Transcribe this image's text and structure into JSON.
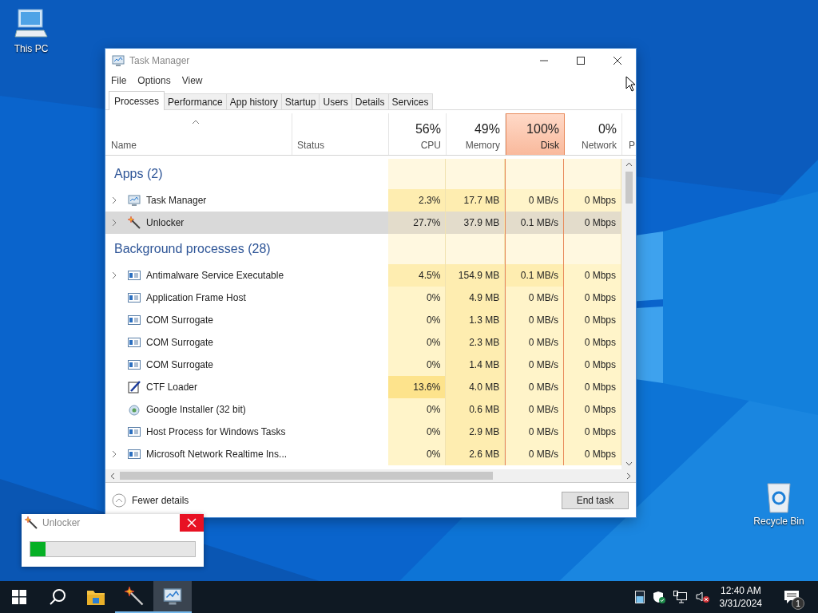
{
  "desktop_icons": [
    {
      "label": "This PC",
      "kind": "pc"
    },
    {
      "label": "Recycle Bin",
      "kind": "bin"
    }
  ],
  "task_manager": {
    "title": "Task Manager",
    "menu": [
      "File",
      "Options",
      "View"
    ],
    "tabs": [
      {
        "label": "Processes",
        "selected": true
      },
      {
        "label": "Performance",
        "selected": false
      },
      {
        "label": "App history",
        "selected": false
      },
      {
        "label": "Startup",
        "selected": false
      },
      {
        "label": "Users",
        "selected": false
      },
      {
        "label": "Details",
        "selected": false
      },
      {
        "label": "Services",
        "selected": false
      }
    ],
    "name_column": "Name",
    "status_column": "Status",
    "metric_columns": [
      {
        "label": "CPU",
        "percent": "56%",
        "selected": false
      },
      {
        "label": "Memory",
        "percent": "49%",
        "selected": false
      },
      {
        "label": "Disk",
        "percent": "100%",
        "selected": true
      },
      {
        "label": "Network",
        "percent": "0%",
        "selected": false
      }
    ],
    "cut_column": "P",
    "groups": [
      {
        "title": "Apps (2)",
        "rows": [
          {
            "name": "Task Manager",
            "kind": "monitor",
            "expandable": true,
            "selected": false,
            "cells": [
              {
                "text": "2.3%",
                "kind": "medium"
              },
              {
                "text": "17.7 MB",
                "kind": "medium"
              },
              {
                "text": "0 MB/s",
                "kind": "light"
              },
              {
                "text": "0 Mbps",
                "kind": "light"
              }
            ]
          },
          {
            "name": "Unlocker",
            "kind": "wand",
            "expandable": true,
            "selected": true,
            "cells": [
              {
                "text": "27.7%",
                "kind": "medium"
              },
              {
                "text": "37.9 MB",
                "kind": "medium"
              },
              {
                "text": "0.1 MB/s",
                "kind": "medium"
              },
              {
                "text": "0 Mbps",
                "kind": "light"
              }
            ]
          }
        ]
      },
      {
        "title": "Background processes (28)",
        "rows": [
          {
            "name": "Antimalware Service Executable",
            "kind": "service",
            "expandable": true,
            "selected": false,
            "cells": [
              {
                "text": "4.5%",
                "kind": "medium"
              },
              {
                "text": "154.9 MB",
                "kind": "medium"
              },
              {
                "text": "0.1 MB/s",
                "kind": "medium"
              },
              {
                "text": "0 Mbps",
                "kind": "light"
              }
            ]
          },
          {
            "name": "Application Frame Host",
            "kind": "service",
            "expandable": false,
            "selected": false,
            "cells": [
              {
                "text": "0%",
                "kind": "light"
              },
              {
                "text": "4.9 MB",
                "kind": "medium"
              },
              {
                "text": "0 MB/s",
                "kind": "light"
              },
              {
                "text": "0 Mbps",
                "kind": "light"
              }
            ]
          },
          {
            "name": "COM Surrogate",
            "kind": "service",
            "expandable": false,
            "selected": false,
            "cells": [
              {
                "text": "0%",
                "kind": "light"
              },
              {
                "text": "1.3 MB",
                "kind": "medium"
              },
              {
                "text": "0 MB/s",
                "kind": "light"
              },
              {
                "text": "0 Mbps",
                "kind": "light"
              }
            ]
          },
          {
            "name": "COM Surrogate",
            "kind": "service",
            "expandable": false,
            "selected": false,
            "cells": [
              {
                "text": "0%",
                "kind": "light"
              },
              {
                "text": "2.3 MB",
                "kind": "medium"
              },
              {
                "text": "0 MB/s",
                "kind": "light"
              },
              {
                "text": "0 Mbps",
                "kind": "light"
              }
            ]
          },
          {
            "name": "COM Surrogate",
            "kind": "service",
            "expandable": false,
            "selected": false,
            "cells": [
              {
                "text": "0%",
                "kind": "light"
              },
              {
                "text": "1.4 MB",
                "kind": "medium"
              },
              {
                "text": "0 MB/s",
                "kind": "light"
              },
              {
                "text": "0 Mbps",
                "kind": "light"
              }
            ]
          },
          {
            "name": "CTF Loader",
            "kind": "pen",
            "expandable": false,
            "selected": false,
            "cells": [
              {
                "text": "13.6%",
                "kind": "strong"
              },
              {
                "text": "4.0 MB",
                "kind": "medium"
              },
              {
                "text": "0 MB/s",
                "kind": "light"
              },
              {
                "text": "0 Mbps",
                "kind": "light"
              }
            ]
          },
          {
            "name": "Google Installer (32 bit)",
            "kind": "installer",
            "expandable": false,
            "selected": false,
            "cells": [
              {
                "text": "0%",
                "kind": "light"
              },
              {
                "text": "0.6 MB",
                "kind": "medium"
              },
              {
                "text": "0 MB/s",
                "kind": "light"
              },
              {
                "text": "0 Mbps",
                "kind": "light"
              }
            ]
          },
          {
            "name": "Host Process for Windows Tasks",
            "kind": "service",
            "expandable": false,
            "selected": false,
            "cells": [
              {
                "text": "0%",
                "kind": "light"
              },
              {
                "text": "2.9 MB",
                "kind": "medium"
              },
              {
                "text": "0 MB/s",
                "kind": "light"
              },
              {
                "text": "0 Mbps",
                "kind": "light"
              }
            ]
          },
          {
            "name": "Microsoft Network Realtime Ins...",
            "kind": "service",
            "expandable": true,
            "selected": false,
            "cells": [
              {
                "text": "0%",
                "kind": "light"
              },
              {
                "text": "2.6 MB",
                "kind": "medium"
              },
              {
                "text": "0 MB/s",
                "kind": "light"
              },
              {
                "text": "0 Mbps",
                "kind": "light"
              }
            ]
          }
        ]
      }
    ],
    "fewer_details": "Fewer details",
    "end_task": "End task"
  },
  "unlocker_window": {
    "title": "Unlocker",
    "level": 0.09
  },
  "taskbar": {
    "apps": [
      {
        "kind": "folder",
        "running": false,
        "active": false
      },
      {
        "kind": "wand",
        "running": true,
        "active": false
      },
      {
        "kind": "monitor",
        "running": true,
        "active": true
      }
    ],
    "time": "12:40 AM",
    "date": "3/31/2024",
    "notification_count": "1"
  }
}
